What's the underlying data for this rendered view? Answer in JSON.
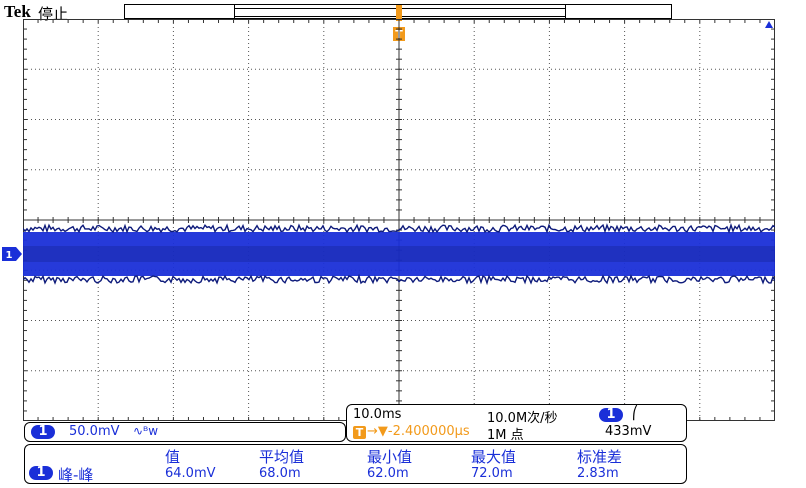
{
  "header": {
    "brand": "Tek",
    "status": "停止"
  },
  "trigger": {
    "marker": "T"
  },
  "channel": {
    "number": "1",
    "scale": "50.0mV",
    "coupling_icon": "bandwidth-limit-icon",
    "coupling_glyph": "∿ᴮw"
  },
  "timebase": {
    "horizontal_scale": "10.0ms",
    "sample_rate": "10.0M次/秒",
    "record_length": "1M 点",
    "trigger_marker": "T",
    "trigger_delay": "→▼-2.400000µs",
    "trigger_source": "1",
    "trigger_slope_glyph": "⎛",
    "trigger_level": "433mV"
  },
  "measurement": {
    "channel": "1",
    "type": "峰-峰",
    "headers": [
      "值",
      "平均值",
      "最小值",
      "最大值",
      "标准差"
    ],
    "values": [
      "64.0mV",
      "68.0m",
      "62.0m",
      "72.0m",
      "2.83m"
    ]
  },
  "colors": {
    "trace": "#1a2fd8",
    "trigger": "#f29a1b",
    "grid": "#555555"
  }
}
